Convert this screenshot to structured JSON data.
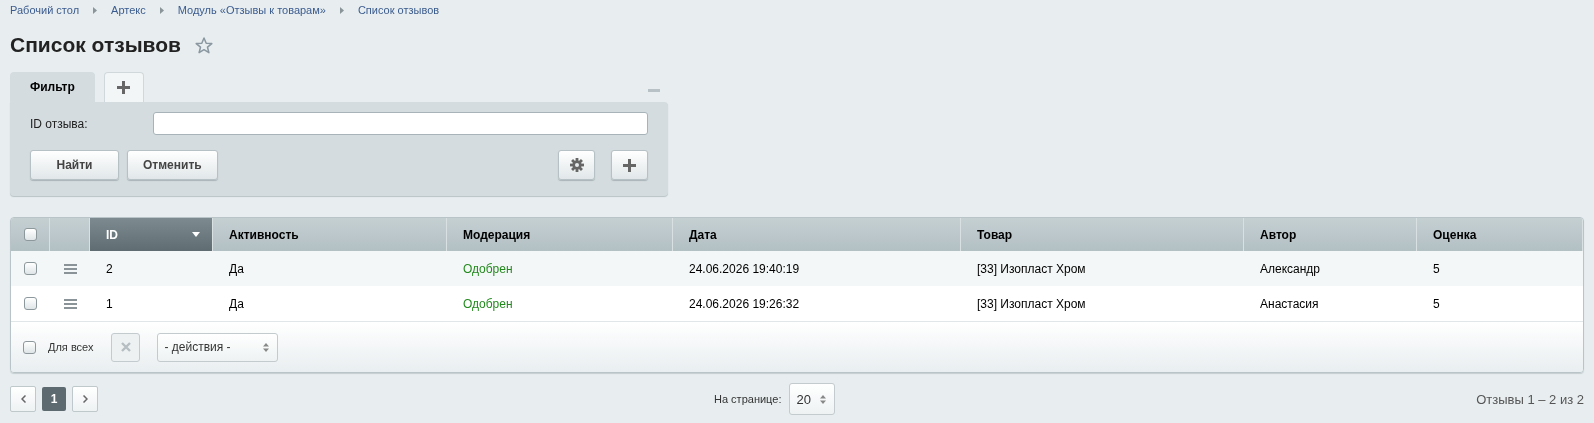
{
  "breadcrumbs": [
    "Рабочий стол",
    "Артекс",
    "Модуль «Отзывы к товарам»",
    "Список отзывов"
  ],
  "page_title": "Список отзывов",
  "filter": {
    "tabs": [
      {
        "label": "Фильтр",
        "selected": true
      }
    ],
    "fields": [
      {
        "label": "ID отзыва:"
      }
    ],
    "buttons": [
      "Найти",
      "Отменить"
    ]
  },
  "table": {
    "header_checked": false,
    "columns": [
      {
        "label": "ID",
        "sorted": true,
        "kind": "text"
      },
      {
        "label": "Активность",
        "sorted": false,
        "kind": "text"
      },
      {
        "label": "Модерация",
        "sorted": false,
        "kind": "status"
      },
      {
        "label": "Дата",
        "sorted": false,
        "kind": "text"
      },
      {
        "label": "Товар",
        "sorted": false,
        "kind": "text"
      },
      {
        "label": "Автор",
        "sorted": false,
        "kind": "text"
      },
      {
        "label": "Оценка",
        "sorted": false,
        "kind": "text"
      }
    ],
    "rows": [
      {
        "checked": false,
        "cells": [
          "2",
          "Да",
          "Одобрен",
          "24.06.2026 19:40:19",
          "[33] Изопласт Хром",
          "Александр",
          "5"
        ]
      },
      {
        "checked": false,
        "cells": [
          "1",
          "Да",
          "Одобрен",
          "24.06.2026 19:26:32",
          "[33] Изопласт Хром",
          "Анастасия",
          "5"
        ]
      }
    ],
    "footer": {
      "select_all_label": "Для всех",
      "select_all_checked": false,
      "actions_placeholder": "- действия -"
    }
  },
  "pager": {
    "pages": [
      {
        "label": "1",
        "selected": true
      }
    ],
    "per_page_label": "На странице:",
    "per_page": "20",
    "summary": "Отзывы 1 – 2 из 2"
  }
}
